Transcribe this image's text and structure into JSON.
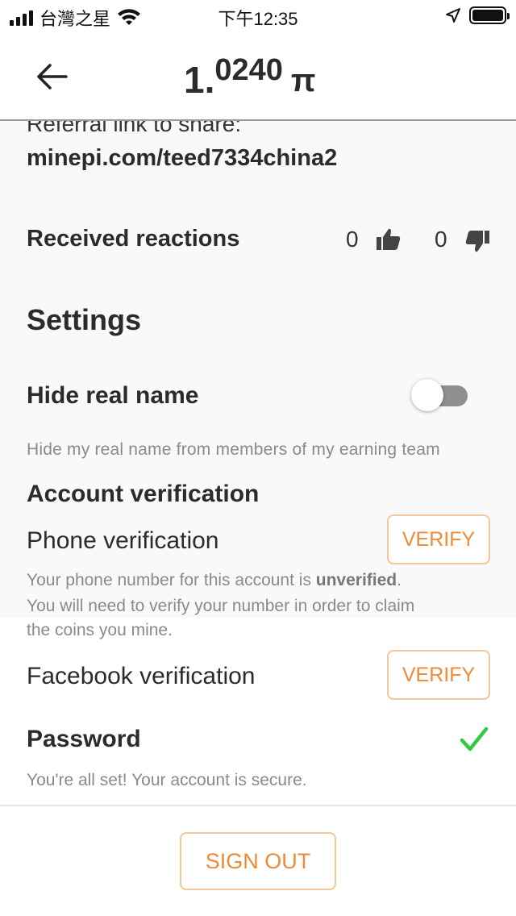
{
  "status_bar": {
    "carrier": "台灣之星",
    "time": "下午12:35"
  },
  "header": {
    "balance_int": "1.",
    "balance_dec": "0240",
    "currency_symbol": "π"
  },
  "profile": {
    "referral_label": "Referral link to share:",
    "referral_link": "minepi.com/teed7334china2",
    "reactions_title": "Received reactions",
    "thumbs_up_count": "0",
    "thumbs_down_count": "0"
  },
  "settings": {
    "title": "Settings",
    "hide_real_name": {
      "title": "Hide real name",
      "description": "Hide my real name from members of my earning team",
      "enabled": false
    },
    "account_verification": {
      "title": "Account verification",
      "phone": {
        "label": "Phone verification",
        "button": "VERIFY",
        "desc_prefix": "Your phone number for this account is ",
        "desc_status": "unverified",
        "desc_suffix": ".",
        "desc_line2": "You will need to verify your number in order to claim",
        "desc_line3": "the coins you mine."
      },
      "facebook": {
        "label": "Facebook verification",
        "button": "VERIFY"
      }
    },
    "password": {
      "title": "Password",
      "description": "You're all set! Your account is secure."
    }
  },
  "footer": {
    "sign_out_label": "SIGN OUT"
  },
  "colors": {
    "accent_orange": "#f08a36",
    "success_green": "#2ecc40"
  }
}
